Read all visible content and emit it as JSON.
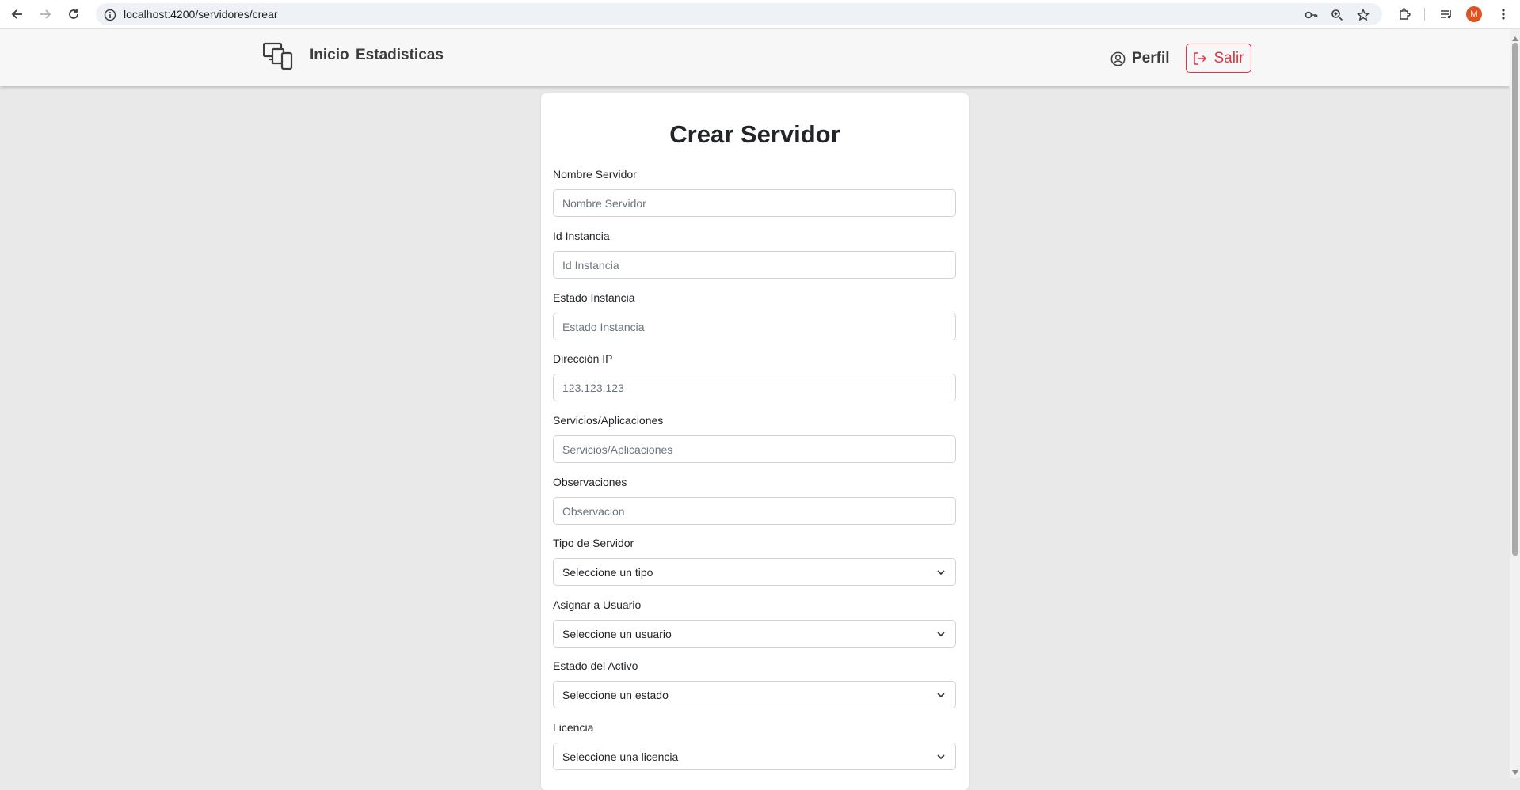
{
  "browser": {
    "url": "localhost:4200/servidores/crear",
    "profile_initial": "M"
  },
  "header": {
    "nav": {
      "inicio": "Inicio",
      "estadisticas": "Estadisticas"
    },
    "perfil_label": "Perfil",
    "salir_label": "Salir"
  },
  "form": {
    "title": "Crear Servidor",
    "fields": [
      {
        "label": "Nombre Servidor",
        "placeholder": "Nombre Servidor"
      },
      {
        "label": "Id Instancia",
        "placeholder": "Id Instancia"
      },
      {
        "label": "Estado Instancia",
        "placeholder": "Estado Instancia"
      },
      {
        "label": "Dirección IP",
        "placeholder": "123.123.123"
      },
      {
        "label": "Servicios/Aplicaciones",
        "placeholder": "Servicios/Aplicaciones"
      },
      {
        "label": "Observaciones",
        "placeholder": "Observacion"
      }
    ],
    "selects": [
      {
        "label": "Tipo de Servidor",
        "value": "Seleccione un tipo"
      },
      {
        "label": "Asignar a Usuario",
        "value": "Seleccione un usuario"
      },
      {
        "label": "Estado del Activo",
        "value": "Seleccione un estado"
      },
      {
        "label": "Licencia",
        "value": "Seleccione una licencia"
      }
    ]
  },
  "colors": {
    "danger": "#dc3545",
    "page_bg": "#e9e9e9",
    "header_bg": "#f7f7f7"
  }
}
